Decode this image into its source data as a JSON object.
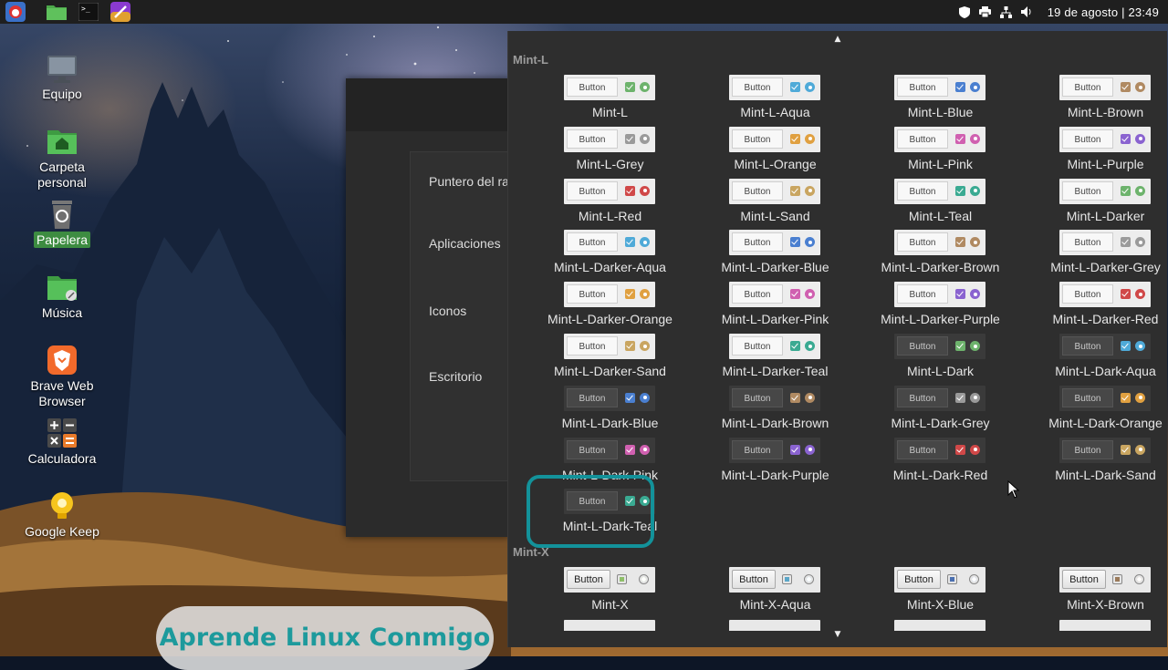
{
  "panel": {
    "launchers": [
      "app-menu-icon",
      "file-manager-icon",
      "terminal-icon",
      "brush-icon"
    ],
    "tray": [
      "shield-icon",
      "printer-icon",
      "network-icon",
      "volume-icon"
    ],
    "clock": "19 de agosto | 23:49"
  },
  "desktop": {
    "icons": [
      {
        "label": "Equipo",
        "icon": "computer-icon"
      },
      {
        "label": "Carpeta personal",
        "icon": "home-folder-icon"
      },
      {
        "label": "Papelera",
        "icon": "trash-icon",
        "selected": true
      },
      {
        "label": "Música",
        "icon": "music-folder-icon"
      },
      {
        "label": "Brave Web Browser",
        "icon": "brave-icon"
      },
      {
        "label": "Calculadora",
        "icon": "calculator-icon"
      },
      {
        "label": "Google Keep",
        "icon": "google-keep-icon"
      }
    ]
  },
  "settings_window": {
    "items": [
      "Puntero del ra",
      "Aplicaciones",
      "Iconos",
      "Escritorio"
    ]
  },
  "theme_chooser": {
    "preview_button_label": "Button",
    "sections": [
      {
        "title": "Mint-L",
        "themes": [
          {
            "name": "Mint-L",
            "color": "#6db36c",
            "dark": false
          },
          {
            "name": "Mint-L-Aqua",
            "color": "#4faad8",
            "dark": false
          },
          {
            "name": "Mint-L-Blue",
            "color": "#4a7fd0",
            "dark": false
          },
          {
            "name": "Mint-L-Brown",
            "color": "#b08a62",
            "dark": false
          },
          {
            "name": "Mint-L-Grey",
            "color": "#9a9a9a",
            "dark": false
          },
          {
            "name": "Mint-L-Orange",
            "color": "#e0a040",
            "dark": false
          },
          {
            "name": "Mint-L-Pink",
            "color": "#d060b0",
            "dark": false
          },
          {
            "name": "Mint-L-Purple",
            "color": "#8a63d0",
            "dark": false
          },
          {
            "name": "Mint-L-Red",
            "color": "#d04848",
            "dark": false
          },
          {
            "name": "Mint-L-Sand",
            "color": "#c9a560",
            "dark": false
          },
          {
            "name": "Mint-L-Teal",
            "color": "#3aaa92",
            "dark": false
          },
          {
            "name": "Mint-L-Darker",
            "color": "#6db36c",
            "dark": false
          },
          {
            "name": "Mint-L-Darker-Aqua",
            "color": "#4faad8",
            "dark": false
          },
          {
            "name": "Mint-L-Darker-Blue",
            "color": "#4a7fd0",
            "dark": false
          },
          {
            "name": "Mint-L-Darker-Brown",
            "color": "#b08a62",
            "dark": false
          },
          {
            "name": "Mint-L-Darker-Grey",
            "color": "#9a9a9a",
            "dark": false
          },
          {
            "name": "Mint-L-Darker-Orange",
            "color": "#e0a040",
            "dark": false
          },
          {
            "name": "Mint-L-Darker-Pink",
            "color": "#d060b0",
            "dark": false
          },
          {
            "name": "Mint-L-Darker-Purple",
            "color": "#8a63d0",
            "dark": false
          },
          {
            "name": "Mint-L-Darker-Red",
            "color": "#d04848",
            "dark": false
          },
          {
            "name": "Mint-L-Darker-Sand",
            "color": "#c9a560",
            "dark": false
          },
          {
            "name": "Mint-L-Darker-Teal",
            "color": "#3aaa92",
            "dark": false
          },
          {
            "name": "Mint-L-Dark",
            "color": "#6db36c",
            "dark": true
          },
          {
            "name": "Mint-L-Dark-Aqua",
            "color": "#4faad8",
            "dark": true
          },
          {
            "name": "Mint-L-Dark-Blue",
            "color": "#4a7fd0",
            "dark": true
          },
          {
            "name": "Mint-L-Dark-Brown",
            "color": "#b08a62",
            "dark": true
          },
          {
            "name": "Mint-L-Dark-Grey",
            "color": "#9a9a9a",
            "dark": true
          },
          {
            "name": "Mint-L-Dark-Orange",
            "color": "#e0a040",
            "dark": true
          },
          {
            "name": "Mint-L-Dark-Pink",
            "color": "#d060b0",
            "dark": true
          },
          {
            "name": "Mint-L-Dark-Purple",
            "color": "#8a63d0",
            "dark": true
          },
          {
            "name": "Mint-L-Dark-Red",
            "color": "#d04848",
            "dark": true
          },
          {
            "name": "Mint-L-Dark-Sand",
            "color": "#c9a560",
            "dark": true
          },
          {
            "name": "Mint-L-Dark-Teal",
            "color": "#3aaa92",
            "dark": true,
            "highlighted": true
          }
        ]
      },
      {
        "title": "Mint-X",
        "themes": [
          {
            "name": "Mint-X",
            "color": "#8fbf6a"
          },
          {
            "name": "Mint-X-Aqua",
            "color": "#5aa6c8"
          },
          {
            "name": "Mint-X-Blue",
            "color": "#4a6fb0"
          },
          {
            "name": "Mint-X-Brown",
            "color": "#9a7a5a"
          }
        ]
      }
    ]
  },
  "watermark": "Aprende Linux Conmigo"
}
